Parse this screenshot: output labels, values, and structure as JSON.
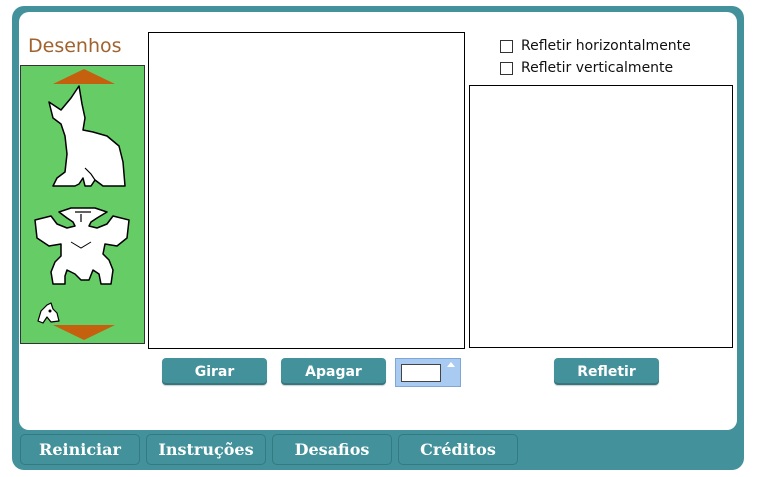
{
  "palette": {
    "title": "Desenhos",
    "shapes": [
      "dog-shape",
      "figure-shape",
      "mouse-shape"
    ]
  },
  "options": {
    "reflect_horizontal": "Refletir horizontalmente",
    "reflect_vertical": "Refletir verticalmente"
  },
  "buttons": {
    "rotate": "Girar",
    "erase": "Apagar",
    "reflect": "Refletir"
  },
  "footer": {
    "tabs": [
      "Reiniciar",
      "Instruções",
      "Desafios",
      "Créditos"
    ]
  },
  "colors": {
    "teal": "#43919a",
    "palette_green": "#66cc66",
    "arrow_orange": "#c5600e",
    "title_brown": "#a0632e"
  }
}
